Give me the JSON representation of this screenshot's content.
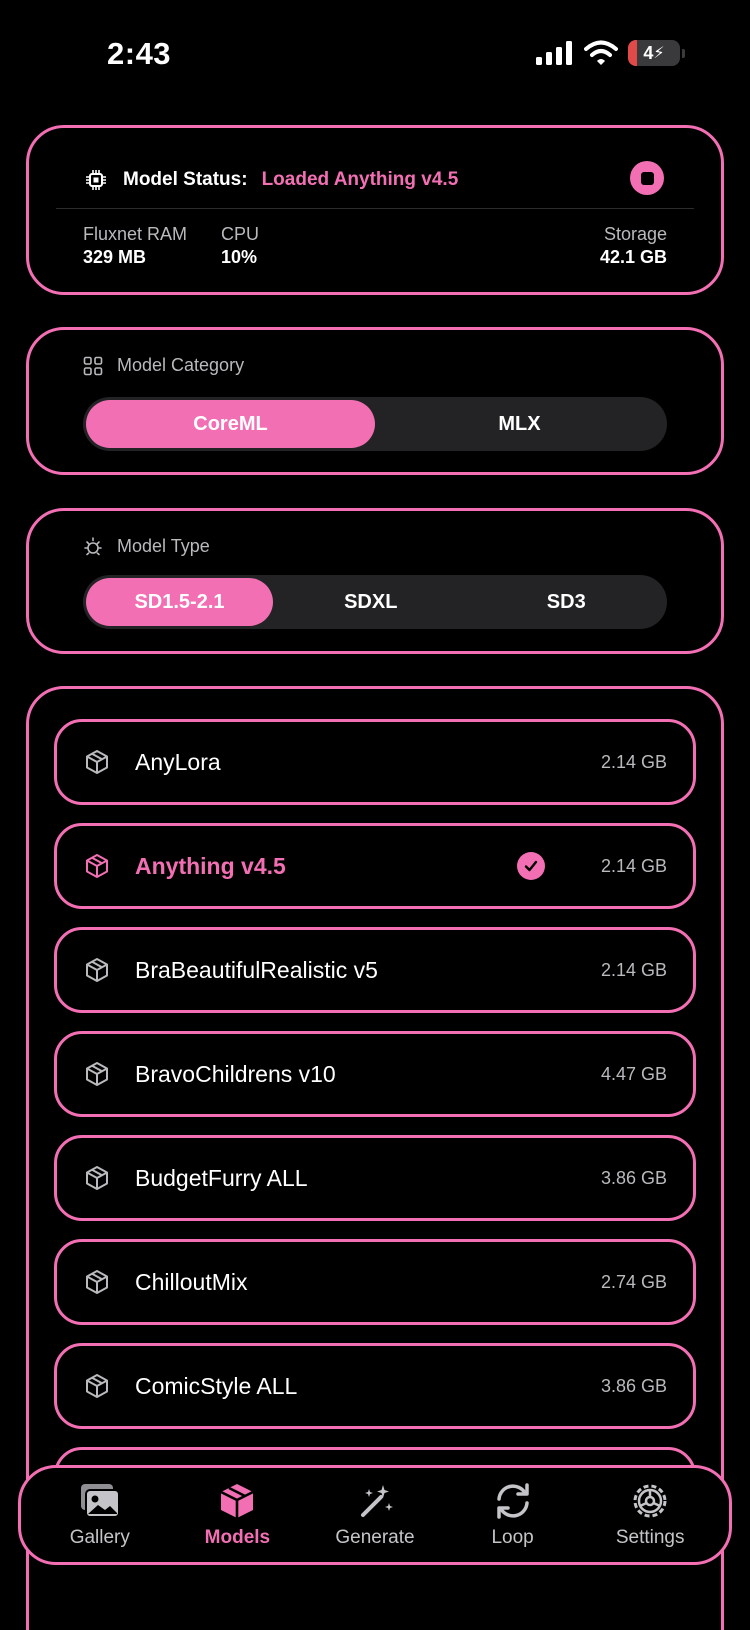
{
  "status_bar": {
    "time": "2:43",
    "battery": "4"
  },
  "model_status": {
    "label": "Model Status:",
    "value": "Loaded Anything v4.5",
    "stats": [
      {
        "label": "Fluxnet RAM",
        "value": "329 MB"
      },
      {
        "label": "CPU",
        "value": "10%"
      },
      {
        "label": "Storage",
        "value": "42.1 GB"
      }
    ]
  },
  "model_category": {
    "title": "Model Category",
    "options": [
      "CoreML",
      "MLX"
    ],
    "selected": "CoreML"
  },
  "model_type": {
    "title": "Model Type",
    "options": [
      "SD1.5-2.1",
      "SDXL",
      "SD3"
    ],
    "selected": "SD1.5-2.1"
  },
  "models": [
    {
      "name": "AnyLora",
      "size": "2.14 GB",
      "selected": false
    },
    {
      "name": "Anything v4.5",
      "size": "2.14 GB",
      "selected": true
    },
    {
      "name": "BraBeautifulRealistic v5",
      "size": "2.14 GB",
      "selected": false
    },
    {
      "name": "BravoChildrens v10",
      "size": "4.47 GB",
      "selected": false
    },
    {
      "name": "BudgetFurry ALL",
      "size": "3.86 GB",
      "selected": false
    },
    {
      "name": "ChilloutMix",
      "size": "2.74 GB",
      "selected": false
    },
    {
      "name": "ComicStyle ALL",
      "size": "3.86 GB",
      "selected": false
    }
  ],
  "tabs": [
    {
      "label": "Gallery",
      "icon": "gallery-icon",
      "active": false
    },
    {
      "label": "Models",
      "icon": "cube-icon",
      "active": true
    },
    {
      "label": "Generate",
      "icon": "magic-wand-icon",
      "active": false
    },
    {
      "label": "Loop",
      "icon": "loop-icon",
      "active": false
    },
    {
      "label": "Settings",
      "icon": "gear-icon",
      "active": false
    }
  ],
  "colors": {
    "accent": "#f36fb4",
    "background": "#000000",
    "segment_bg": "#232325",
    "muted_text": "#b9b9be"
  }
}
